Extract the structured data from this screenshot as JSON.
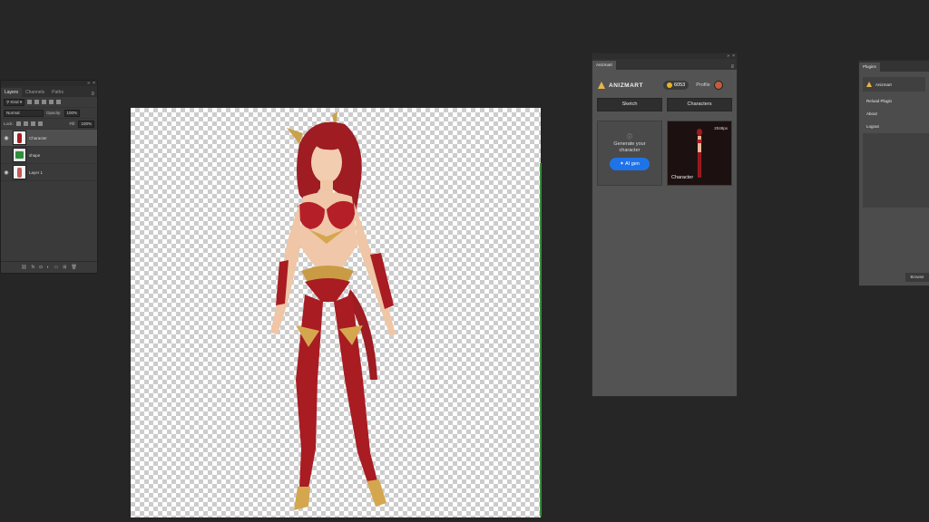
{
  "layers_panel": {
    "tabs": [
      "Layers",
      "Channels",
      "Paths"
    ],
    "filter": "Kind",
    "blend_mode": "Normal",
    "opacity_label": "Opacity:",
    "opacity_value": "100%",
    "lock_label": "Lock:",
    "fill_label": "Fill:",
    "fill_value": "100%",
    "layers": [
      {
        "name": "Character",
        "visible": true,
        "selected": true
      },
      {
        "name": "shape",
        "visible": false,
        "selected": false
      },
      {
        "name": "Layer 1",
        "visible": true,
        "selected": false
      }
    ],
    "bottom_icons": [
      "link-icon",
      "fx-icon",
      "mask-icon",
      "adjustment-icon",
      "folder-icon",
      "new-layer-icon",
      "trash-icon"
    ]
  },
  "anizmart_panel": {
    "tab_label": "Anizmart",
    "brand": "ANIZMART",
    "credits": "6053",
    "profile_label": "Profile",
    "tabs": [
      "Sketch",
      "Characters"
    ],
    "generate_text": "Generate your character",
    "ai_button_label": "AI gen",
    "character_card": {
      "size_label": "2048px",
      "label": "Character"
    }
  },
  "plugins_panel": {
    "tab_label": "Plugins",
    "plugin_name": "Anizmart",
    "menu_items": [
      "Reload Plugin",
      "About",
      "Logout",
      "Anizmart"
    ],
    "bottom_button": "Browse"
  },
  "colors": {
    "workspace_bg": "#262626",
    "panel_bg": "#535353",
    "accent_blue": "#1f73e8",
    "brand_gold": "#e7b54a",
    "character_red": "#a81c22"
  }
}
